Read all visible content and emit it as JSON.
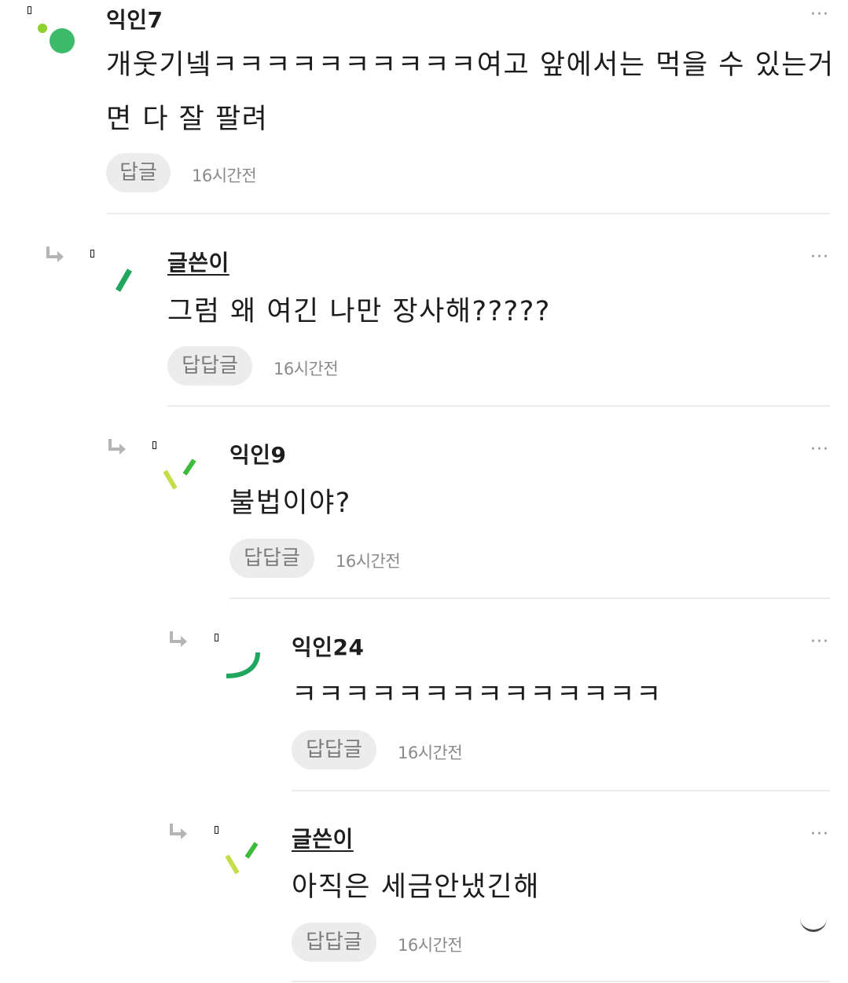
{
  "comments": [
    {
      "author": "익인7",
      "text_lines": [
        "개웃기넼ㅋㅋㅋㅋㅋㅋㅋㅋㅋㅋ여고 앞에서는 먹을 수 있는거",
        "면 다 잘 팔려"
      ],
      "reply_label": "답글",
      "time": "16시간전",
      "more": "···"
    },
    {
      "author": "글쓴이",
      "text_lines": [
        "그럼 왜 여긴 나만 장사해?????"
      ],
      "reply_label": "답답글",
      "time": "16시간전",
      "more": "···"
    },
    {
      "author": "익인9",
      "text_lines": [
        "불법이야?"
      ],
      "reply_label": "답답글",
      "time": "16시간전",
      "more": "···"
    },
    {
      "author": "익인24",
      "text_lines": [
        "ㅋㅋㅋㅋㅋㅋㅋㅋㅋㅋㅋㅋㅋㅋ"
      ],
      "reply_label": "답답글",
      "time": "16시간전",
      "more": "···"
    },
    {
      "author": "글쓴이",
      "text_lines": [
        "아직은 세금안냈긴해"
      ],
      "reply_label": "답답글",
      "time": "16시간전",
      "more": "···"
    }
  ],
  "colors": {
    "green_dark": "#3dbb6a",
    "green_mid": "#1fa65f",
    "lime": "#8fd12e",
    "yellow_green": "#c6dc4a"
  }
}
